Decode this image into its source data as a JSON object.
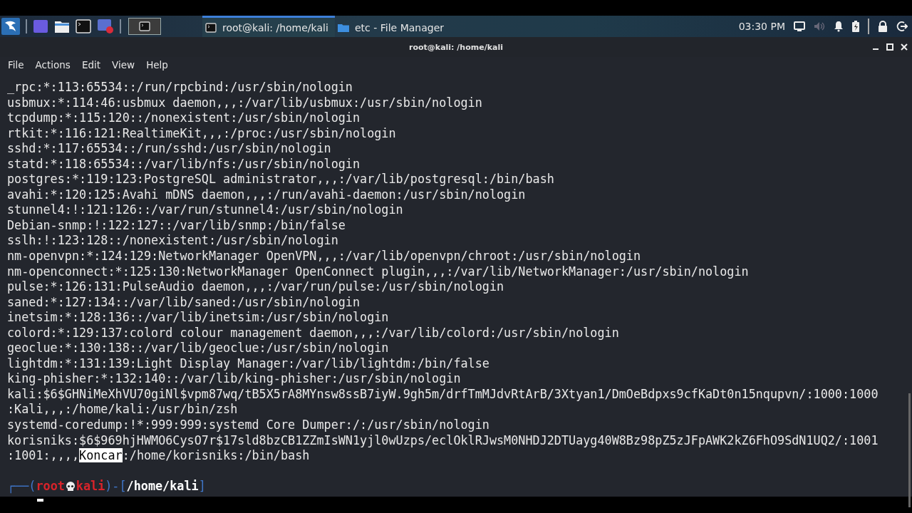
{
  "taskbar": {
    "workspaces": [
      {
        "selected": true
      }
    ],
    "windows": [
      {
        "title": "root@kali: /home/kali",
        "kind": "terminal",
        "selected": true
      },
      {
        "title": "etc - File Manager",
        "kind": "folder",
        "selected": false
      }
    ],
    "clock": "03:30 PM"
  },
  "window": {
    "title": "root@kali: /home/kali"
  },
  "menu": [
    "File",
    "Actions",
    "Edit",
    "View",
    "Help"
  ],
  "terminal": {
    "lines": [
      {
        "parts": [
          {
            "text": "_rpc:*:113:65534::/run/rpcbind:/usr/sbin/nologin",
            "selected": false
          }
        ]
      },
      {
        "parts": [
          {
            "text": "usbmux:*:114:46:usbmux daemon,,,:/var/lib/usbmux:/usr/sbin/nologin",
            "selected": false
          }
        ]
      },
      {
        "parts": [
          {
            "text": "tcpdump:*:115:120::/nonexistent:/usr/sbin/nologin",
            "selected": false
          }
        ]
      },
      {
        "parts": [
          {
            "text": "rtkit:*:116:121:RealtimeKit,,,:/proc:/usr/sbin/nologin",
            "selected": false
          }
        ]
      },
      {
        "parts": [
          {
            "text": "sshd:*:117:65534::/run/sshd:/usr/sbin/nologin",
            "selected": false
          }
        ]
      },
      {
        "parts": [
          {
            "text": "statd:*:118:65534::/var/lib/nfs:/usr/sbin/nologin",
            "selected": false
          }
        ]
      },
      {
        "parts": [
          {
            "text": "postgres:*:119:123:PostgreSQL administrator,,,:/var/lib/postgresql:/bin/bash",
            "selected": false
          }
        ]
      },
      {
        "parts": [
          {
            "text": "avahi:*:120:125:Avahi mDNS daemon,,,:/run/avahi-daemon:/usr/sbin/nologin",
            "selected": false
          }
        ]
      },
      {
        "parts": [
          {
            "text": "stunnel4:!:121:126::/var/run/stunnel4:/usr/sbin/nologin",
            "selected": false
          }
        ]
      },
      {
        "parts": [
          {
            "text": "Debian-snmp:!:122:127::/var/lib/snmp:/bin/false",
            "selected": false
          }
        ]
      },
      {
        "parts": [
          {
            "text": "sslh:!:123:128::/nonexistent:/usr/sbin/nologin",
            "selected": false
          }
        ]
      },
      {
        "parts": [
          {
            "text": "nm-openvpn:*:124:129:NetworkManager OpenVPN,,,:/var/lib/openvpn/chroot:/usr/sbin/nologin",
            "selected": false
          }
        ]
      },
      {
        "parts": [
          {
            "text": "nm-openconnect:*:125:130:NetworkManager OpenConnect plugin,,,:/var/lib/NetworkManager:/usr/sbin/nologin",
            "selected": false
          }
        ]
      },
      {
        "parts": [
          {
            "text": "pulse:*:126:131:PulseAudio daemon,,,:/var/run/pulse:/usr/sbin/nologin",
            "selected": false
          }
        ]
      },
      {
        "parts": [
          {
            "text": "saned:*:127:134::/var/lib/saned:/usr/sbin/nologin",
            "selected": false
          }
        ]
      },
      {
        "parts": [
          {
            "text": "inetsim:*:128:136::/var/lib/inetsim:/usr/sbin/nologin",
            "selected": false
          }
        ]
      },
      {
        "parts": [
          {
            "text": "colord:*:129:137:colord colour management daemon,,,:/var/lib/colord:/usr/sbin/nologin",
            "selected": false
          }
        ]
      },
      {
        "parts": [
          {
            "text": "geoclue:*:130:138::/var/lib/geoclue:/usr/sbin/nologin",
            "selected": false
          }
        ]
      },
      {
        "parts": [
          {
            "text": "lightdm:*:131:139:Light Display Manager:/var/lib/lightdm:/bin/false",
            "selected": false
          }
        ]
      },
      {
        "parts": [
          {
            "text": "king-phisher:*:132:140::/var/lib/king-phisher:/usr/sbin/nologin",
            "selected": false
          }
        ]
      },
      {
        "parts": [
          {
            "text": "kali:$6$GHNiMeXhVU70giNl$vpm87wq/tB5X5rA8MYnsw8ssB7iyW.9gh5m/drfTmMJdvRtArB/3Xtyan1/DmOeBdpxs9cfKaDt0n15nqupvn/:1000:1000",
            "selected": false
          }
        ]
      },
      {
        "parts": [
          {
            "text": ":Kali,,,:/home/kali:/usr/bin/zsh",
            "selected": false
          }
        ]
      },
      {
        "parts": [
          {
            "text": "systemd-coredump:!*:999:999:systemd Core Dumper:/:/usr/sbin/nologin",
            "selected": false
          }
        ]
      },
      {
        "parts": [
          {
            "text": "korisniks:$6$969hjHWMO6CysO7r$17sld8bzCB1ZZmIsWN1yjl0wUzps/eclOklRJwsM0NHDJ2DTUayg40W8Bz98pZ5zJFpAWK2kZ6FhO9SdN1UQ2/:1001",
            "selected": false
          }
        ]
      },
      {
        "parts": [
          {
            "text": ":1001:,,,,",
            "selected": false
          },
          {
            "text": "Koncar",
            "selected": true
          },
          {
            "text": ":/home/korisniks:/bin/bash",
            "selected": false
          }
        ]
      }
    ],
    "prompt": {
      "corner": "┌──(",
      "user": "root",
      "host": "kali",
      "middle": ")-[",
      "dir": "/home/kali",
      "end": "]"
    }
  }
}
